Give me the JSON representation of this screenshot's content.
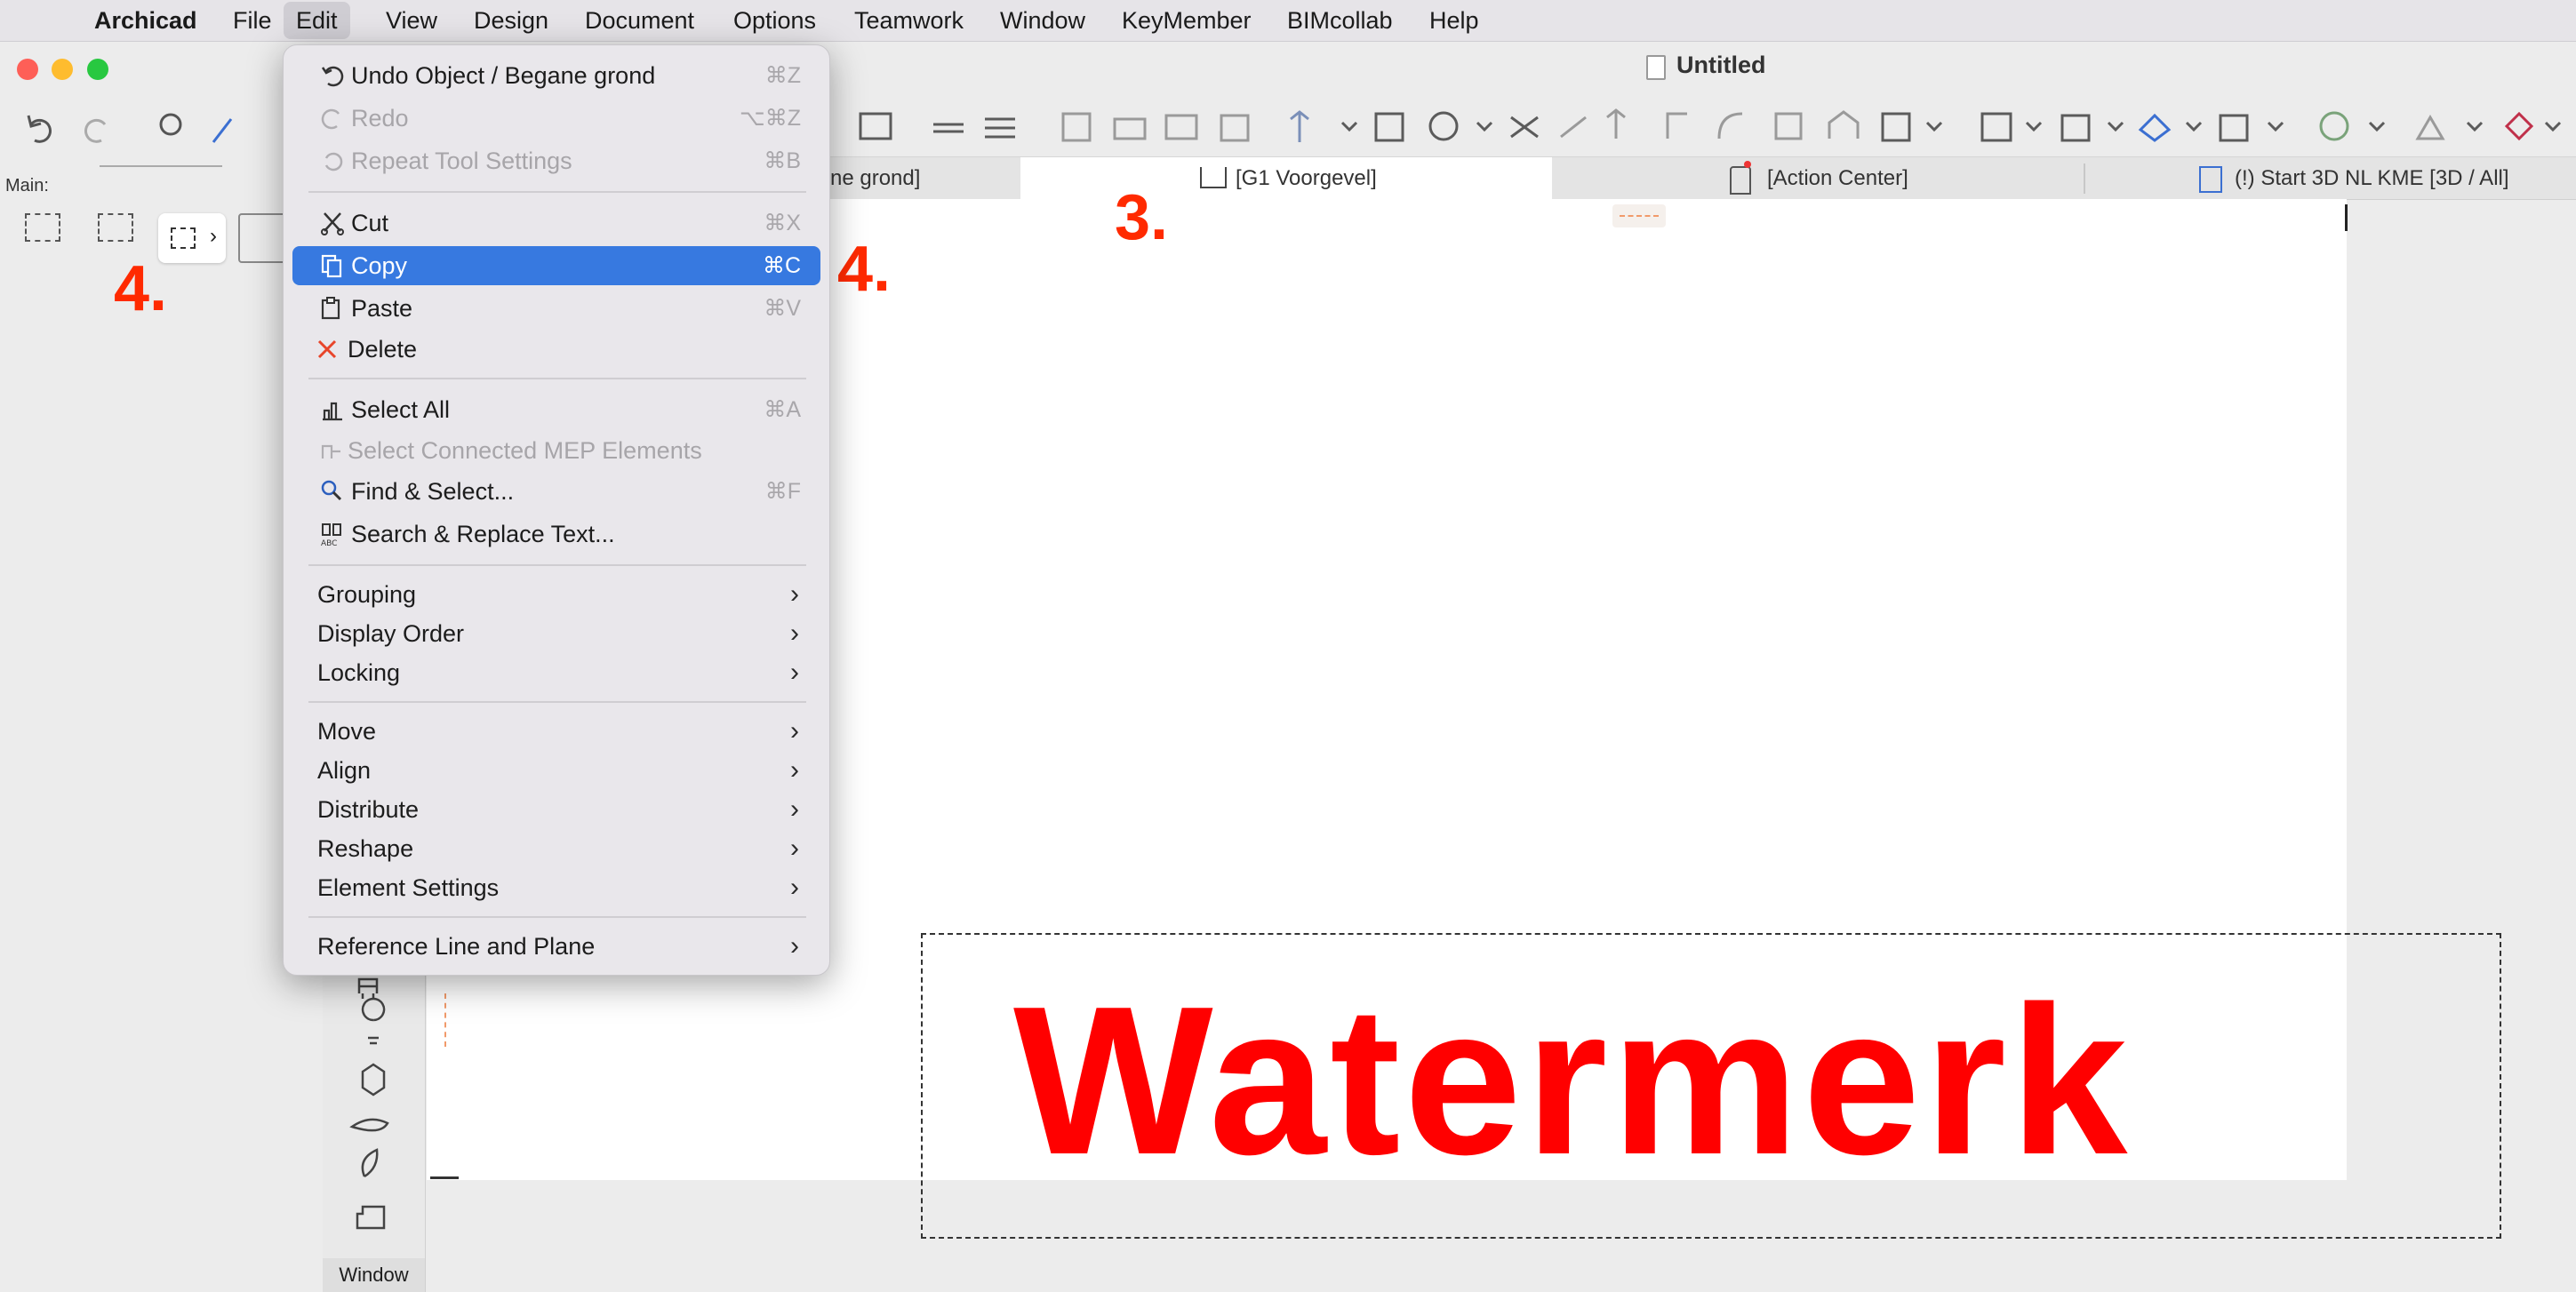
{
  "menubar": {
    "apple": "",
    "items": [
      "Archicad",
      "File",
      "Edit",
      "View",
      "Design",
      "Document",
      "Options",
      "Teamwork",
      "Window",
      "KeyMember",
      "BIMcollab",
      "Help"
    ]
  },
  "window": {
    "title": "Untitled"
  },
  "left_panel": {
    "label": "Main:"
  },
  "tabs": [
    "ne grond]",
    "[G1 Voorgevel]",
    "[Action Center]",
    "(!) Start 3D NL KME [3D / All]"
  ],
  "toolbox": {
    "footer": "Window"
  },
  "annotations": [
    "3.",
    "4.",
    "4."
  ],
  "watermark": "Watermerk",
  "edit_menu": {
    "items": [
      {
        "label": "Undo Object / Begane grond",
        "shortcut": "⌘Z",
        "icon": "undo-icon"
      },
      {
        "label": "Redo",
        "shortcut": "⌥⌘Z",
        "icon": "redo-icon",
        "disabled": true
      },
      {
        "label": "Repeat Tool Settings",
        "shortcut": "⌘B",
        "icon": "repeat-icon",
        "disabled": true
      },
      {
        "label": "Cut",
        "shortcut": "⌘X",
        "icon": "scissors-icon"
      },
      {
        "label": "Copy",
        "shortcut": "⌘C",
        "icon": "copy-icon",
        "selected": true
      },
      {
        "label": "Paste",
        "shortcut": "⌘V",
        "icon": "paste-icon"
      },
      {
        "label": "Delete",
        "shortcut": "",
        "icon": "delete-x-icon"
      },
      {
        "label": "Select All",
        "shortcut": "⌘A",
        "icon": "select-all-icon"
      },
      {
        "label": "Select Connected MEP Elements",
        "shortcut": "",
        "icon": "mep-icon",
        "disabled": true
      },
      {
        "label": "Find & Select...",
        "shortcut": "⌘F",
        "icon": "find-icon"
      },
      {
        "label": "Search & Replace Text...",
        "shortcut": "",
        "icon": "binoculars-icon"
      },
      {
        "label": "Grouping",
        "submenu": true
      },
      {
        "label": "Display Order",
        "submenu": true
      },
      {
        "label": "Locking",
        "submenu": true
      },
      {
        "label": "Move",
        "submenu": true
      },
      {
        "label": "Align",
        "submenu": true
      },
      {
        "label": "Distribute",
        "submenu": true
      },
      {
        "label": "Reshape",
        "submenu": true
      },
      {
        "label": "Element Settings",
        "submenu": true
      },
      {
        "label": "Reference Line and Plane",
        "submenu": true
      }
    ]
  },
  "colors": {
    "accent": "#3779e0",
    "annotation": "#ff2a00",
    "watermark": "#ff0000"
  }
}
